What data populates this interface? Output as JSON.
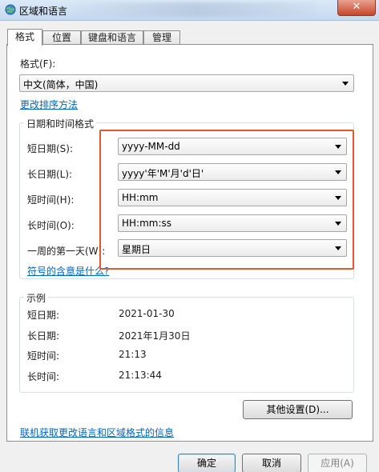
{
  "window": {
    "title": "区域和语言",
    "close_label": "✕"
  },
  "tabs": [
    {
      "label": "格式"
    },
    {
      "label": "位置"
    },
    {
      "label": "键盘和语言"
    },
    {
      "label": "管理"
    }
  ],
  "format": {
    "label": "格式(F):",
    "selected": "中文(简体，中国)",
    "sort_link": "更改排序方法"
  },
  "datetime": {
    "group_title": "日期和时间格式",
    "rows": [
      {
        "label": "短日期(S):",
        "value": "yyyy-MM-dd"
      },
      {
        "label": "长日期(L):",
        "value": "yyyy'年'M'月'd'日'"
      },
      {
        "label": "短时间(H):",
        "value": "HH:mm"
      },
      {
        "label": "长时间(O):",
        "value": "HH:mm:ss"
      },
      {
        "label": "一周的第一天(W):",
        "value": "星期日"
      }
    ],
    "symbols_link": "符号的含意是什么?"
  },
  "examples": {
    "group_title": "示例",
    "rows": [
      {
        "label": "短日期:",
        "value": "2021-01-30"
      },
      {
        "label": "长日期:",
        "value": "2021年1月30日"
      },
      {
        "label": "短时间:",
        "value": "21:13"
      },
      {
        "label": "长时间:",
        "value": "21:13:44"
      }
    ]
  },
  "other_settings_button": "其他设置(D)...",
  "online_link": "联机获取更改语言和区域格式的信息",
  "footer": {
    "ok": "确定",
    "cancel": "取消",
    "apply": "应用(A)"
  },
  "colors": {
    "highlight": "#e05a2b",
    "link": "#0066cc",
    "close": "#c9452d"
  }
}
